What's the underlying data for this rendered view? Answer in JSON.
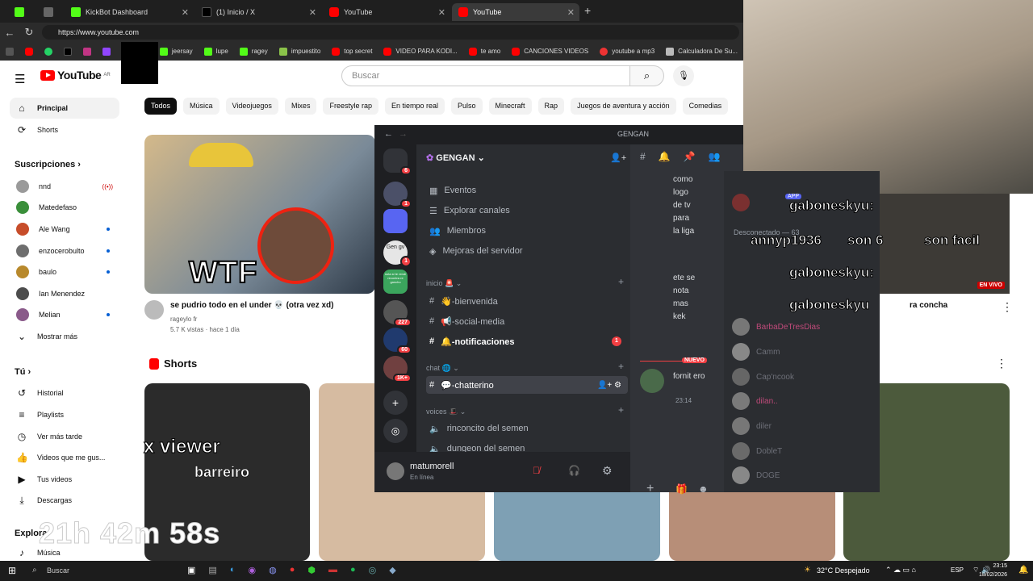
{
  "browser": {
    "tabs": [
      {
        "title": "",
        "icon": "kick"
      },
      {
        "title": "",
        "icon": "generic"
      },
      {
        "title": "KickBot Dashboard",
        "icon": "kick"
      },
      {
        "title": "(1) Inicio / X",
        "icon": "x"
      },
      {
        "title": "YouTube",
        "icon": "youtube"
      },
      {
        "title": "YouTube",
        "icon": "youtube",
        "active": true
      }
    ],
    "url": "https://www.youtube.com",
    "bookmarks": [
      "jeersay",
      "lupe",
      "ragey",
      "impuestito",
      "top secret",
      "VIDEO PARA KODI...",
      "te amo",
      "CANCIONES VIDEOS",
      "youtube a mp3",
      "Calculadora De Su..."
    ]
  },
  "youtube": {
    "logo_text": "YouTube",
    "country": "AR",
    "search_placeholder": "Buscar",
    "sidebar": {
      "main": [
        {
          "label": "Principal",
          "icon": "home-icon",
          "active": true
        },
        {
          "label": "Shorts",
          "icon": "shorts-icon"
        }
      ],
      "subs_title": "Suscripciones",
      "subs": [
        {
          "label": "nnd",
          "color": "#9a9a9a",
          "live": true
        },
        {
          "label": "Matedefaso",
          "color": "#3a8f3a"
        },
        {
          "label": "Ale Wang",
          "color": "#c74d2a",
          "new": true
        },
        {
          "label": "enzocerobulto",
          "color": "#6e6e6e",
          "new": true
        },
        {
          "label": "baulo",
          "color": "#b8892c",
          "new": true
        },
        {
          "label": "Ian Menendez",
          "color": "#4c4c4c"
        },
        {
          "label": "Melian",
          "color": "#8a5a8a",
          "new": true
        },
        {
          "label": "Mostrar más",
          "icon": "chevron-down-icon"
        }
      ],
      "you_title": "Tú",
      "you": [
        {
          "label": "Historial",
          "icon": "history-icon"
        },
        {
          "label": "Playlists",
          "icon": "playlist-icon"
        },
        {
          "label": "Ver más tarde",
          "icon": "clock-icon"
        },
        {
          "label": "Videos que me gus...",
          "icon": "like-icon"
        },
        {
          "label": "Tus videos",
          "icon": "video-icon"
        },
        {
          "label": "Descargas",
          "icon": "download-icon"
        }
      ],
      "explore_title": "Explorar",
      "explore": [
        {
          "label": "Música",
          "icon": "music-icon"
        }
      ]
    },
    "chips": [
      "Todos",
      "Música",
      "Videojuegos",
      "Mixes",
      "Freestyle rap",
      "En tiempo real",
      "Pulso",
      "Minecraft",
      "Rap",
      "Juegos de aventura y acción",
      "Comedias"
    ],
    "video": {
      "title": "se pudrio todo en el under 💀 (otra vez xd)",
      "channel": "rageylo fr",
      "meta": "5.7 K vistas · hace 1 día",
      "thumb_text": "WTF"
    },
    "video2": {
      "title": "ra concha",
      "live_badge": "EN VIVO"
    },
    "shorts_title": "Shorts",
    "short1_overlay": "barreiro"
  },
  "discord": {
    "window_title": "GENGAN",
    "server_name": "GENGAN",
    "guild_badges": [
      "6",
      "1",
      "1",
      "227",
      "60",
      "1K+"
    ],
    "guild_tiles": [
      "Gen gv",
      "nota si te rendí recontra re gancho"
    ],
    "menu": [
      "Eventos",
      "Explorar canales",
      "Miembros",
      "Mejoras del servidor"
    ],
    "cat_inicio": "inicio 🚨",
    "channels_inicio": [
      "👋-bienvenida",
      "📢-social-media",
      "🔔-notificaciones"
    ],
    "notif_badge": "1",
    "cat_chat": "chat 🌐",
    "channel_active": "💬-chatterino",
    "cat_voices": "voices 🎩",
    "voice_channels": [
      "rinconcito del semen",
      "dungeon del semen"
    ],
    "user": {
      "name": "matumorell",
      "status": "En línea"
    },
    "chat_lines": [
      "como",
      "logo",
      "de tv",
      "para",
      "la liga",
      "ete se",
      "nota",
      "mas",
      "kek"
    ],
    "new_badge": "NUEVO",
    "message_author": "fornit ero",
    "message_time": "23:14",
    "members_header": "Desconectado — 63",
    "app_badge": "APP",
    "members": [
      "BarbaDeTresDias",
      "Camm",
      "Cap'ncook",
      "dilan..",
      "diler",
      "DobleT",
      "DOGE"
    ]
  },
  "overlay": {
    "chat": [
      {
        "user": "gaboneskyu:",
        "msg": ""
      },
      {
        "user": "annyp1936",
        "msg": "son 6"
      },
      {
        "user": "",
        "msg": "son facil"
      },
      {
        "user": "gaboneskyu:",
        "msg": ""
      },
      {
        "user": "gaboneskyu",
        "msg": ""
      }
    ],
    "timer": "21h 42m 58s",
    "stream_text": "x viewer"
  },
  "taskbar": {
    "search": "Buscar",
    "weather": "32°C  Despejado",
    "lang": "ESP",
    "time": "23:15",
    "date": "18/02/2026"
  }
}
